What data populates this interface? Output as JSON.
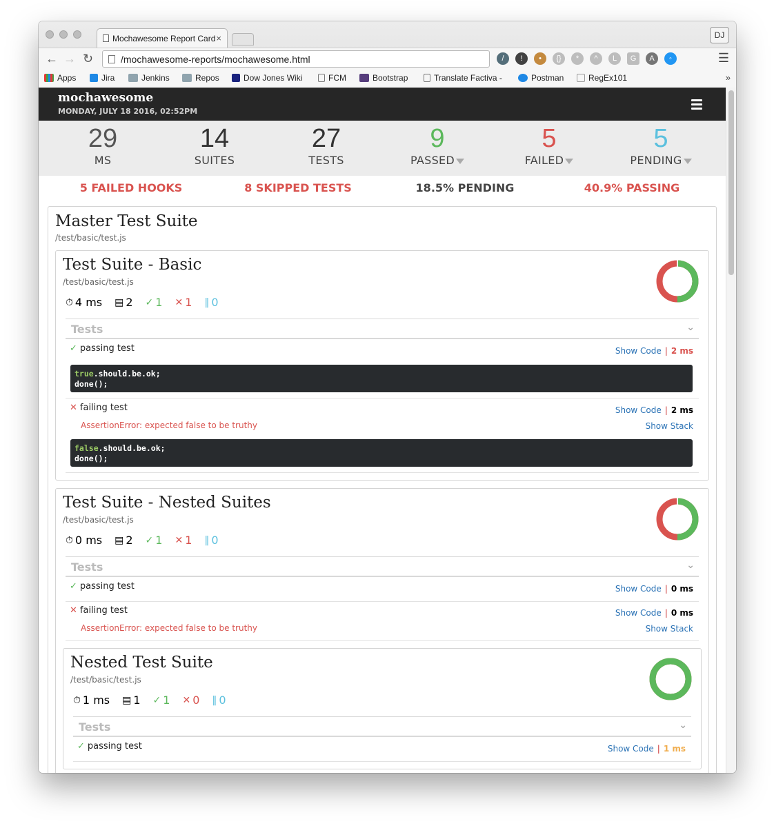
{
  "browser": {
    "tab_title": "Mochawesome Report Card",
    "tab_close": "×",
    "url": "/mochawesome-reports/mochawesome.html",
    "profile": "DJ",
    "bookmarks": [
      {
        "label": "Apps",
        "color": "#e53935"
      },
      {
        "label": "Jira",
        "color": "#1e88e5"
      },
      {
        "label": "Jenkins",
        "color": "#90a4ae"
      },
      {
        "label": "Repos",
        "color": "#90a4ae"
      },
      {
        "label": "Dow Jones Wiki",
        "color": "#1a237e"
      },
      {
        "label": "FCM",
        "color": "#ffffff"
      },
      {
        "label": "Bootstrap",
        "color": "#563d7c"
      },
      {
        "label": "Translate Factiva -",
        "color": "#ffffff"
      },
      {
        "label": "Postman",
        "color": "#1e88e5"
      },
      {
        "label": "RegEx101",
        "color": "#ffffff"
      }
    ],
    "bookmarks_more": "»"
  },
  "header": {
    "title": "mochawesome",
    "date": "MONDAY, JULY 18 2016, 02:52PM"
  },
  "stats": [
    {
      "value": "29",
      "label": "MS",
      "color": "#555555",
      "filter": false
    },
    {
      "value": "14",
      "label": "SUITES",
      "color": "#333333",
      "filter": false
    },
    {
      "value": "27",
      "label": "TESTS",
      "color": "#333333",
      "filter": false
    },
    {
      "value": "9",
      "label": "PASSED",
      "color": "#5cb85c",
      "filter": true
    },
    {
      "value": "5",
      "label": "FAILED",
      "color": "#d9534f",
      "filter": true
    },
    {
      "value": "5",
      "label": "PENDING",
      "color": "#5bc0de",
      "filter": true
    }
  ],
  "summary": {
    "failed_hooks": "5 FAILED HOOKS",
    "skipped_tests": "8 SKIPPED TESTS",
    "pending_pct": "18.5% PENDING",
    "passing_pct": "40.9% PASSING"
  },
  "colors": {
    "pass": "#5cb85c",
    "fail": "#d9534f",
    "pending": "#5bc0de",
    "link": "#2a72b5",
    "slow": "#f0ad4e"
  },
  "master": {
    "title": "Master Test Suite",
    "file": "/test/basic/test.js"
  },
  "suites": [
    {
      "title": "Test Suite - Basic",
      "file": "/test/basic/test.js",
      "duration": "4 ms",
      "tests": "2",
      "passed": "1",
      "failed": "1",
      "pending": "0",
      "pass_fraction": 0.5,
      "tests_header": "Tests",
      "rows": [
        {
          "name": "passing test",
          "status": "pass",
          "show_code": "Show Code",
          "duration": "2 ms",
          "duration_color": "#d9534f",
          "code": [
            "true",
            ".should.be.ok;",
            "done();"
          ]
        },
        {
          "name": "failing test",
          "status": "fail",
          "show_code": "Show Code",
          "duration": "2 ms",
          "duration_color": "#333333",
          "error": "AssertionError: expected false to be truthy",
          "show_stack": "Show Stack",
          "code": [
            "false",
            ".should.be.ok;",
            "done();"
          ]
        }
      ]
    },
    {
      "title": "Test Suite - Nested Suites",
      "file": "/test/basic/test.js",
      "duration": "0 ms",
      "tests": "2",
      "passed": "1",
      "failed": "1",
      "pending": "0",
      "pass_fraction": 0.5,
      "tests_header": "Tests",
      "rows": [
        {
          "name": "passing test",
          "status": "pass",
          "show_code": "Show Code",
          "duration": "0 ms",
          "duration_color": "#333333"
        },
        {
          "name": "failing test",
          "status": "fail",
          "show_code": "Show Code",
          "duration": "0 ms",
          "duration_color": "#333333",
          "error": "AssertionError: expected false to be truthy",
          "show_stack": "Show Stack"
        }
      ]
    },
    {
      "title": "Nested Test Suite",
      "file": "/test/basic/test.js",
      "duration": "1 ms",
      "tests": "1",
      "passed": "1",
      "failed": "0",
      "pending": "0",
      "pass_fraction": 1.0,
      "tests_header": "Tests",
      "rows": [
        {
          "name": "passing test",
          "status": "pass",
          "show_code": "Show Code",
          "duration": "1 ms",
          "duration_color": "#f0ad4e"
        }
      ]
    }
  ]
}
